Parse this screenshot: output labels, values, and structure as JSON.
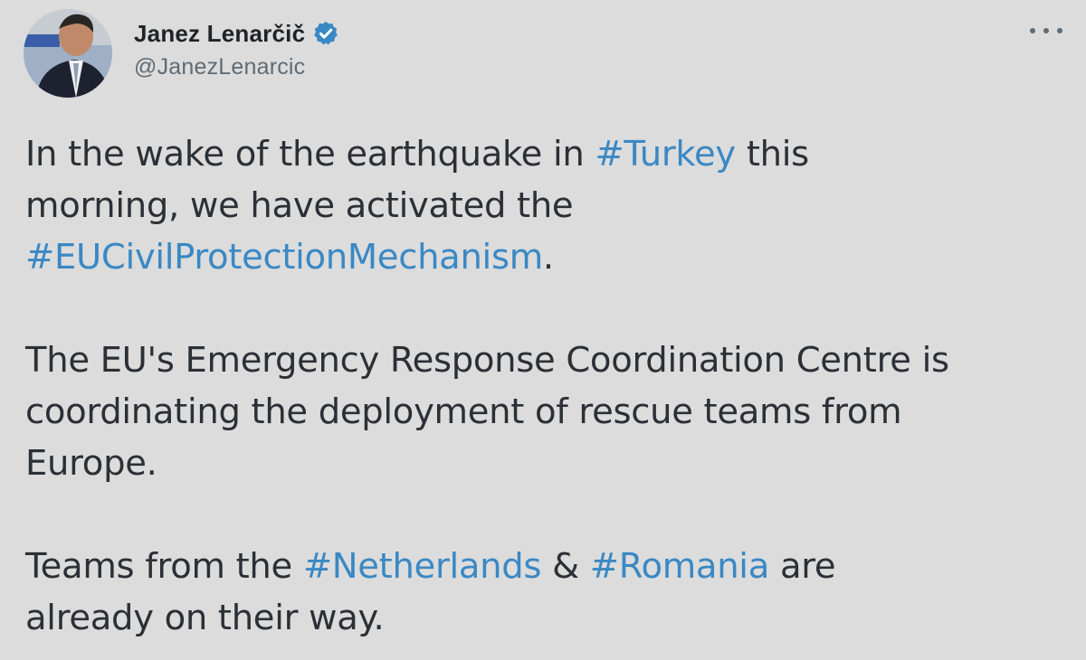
{
  "author": {
    "display_name": "Janez Lenarčič",
    "handle": "@JanezLenarcic",
    "verified_icon": "verified-badge-icon",
    "avatar": "profile-photo",
    "more_icon": "more-options-icon"
  },
  "tweet": {
    "p1": {
      "t1": "In the wake of the earthquake in ",
      "tag1": "#Turkey",
      "t2": " this",
      "line2": "morning, we have activated the",
      "tag2": "#EUCivilProtectionMechanism",
      "t3": "."
    },
    "p2": {
      "line1": "The EU's Emergency Response Coordination Centre is",
      "line2": "coordinating the deployment of rescue teams from",
      "line3": "Europe."
    },
    "p3": {
      "t1": "Teams from the ",
      "tag1": "#Netherlands",
      "t2": " & ",
      "tag2": "#Romania",
      "t3": " are",
      "line2": "already on their way."
    }
  },
  "colors": {
    "background": "#dcdcdc",
    "text": "#2b3036",
    "hashtag": "#3a88c4",
    "verified": "#3a88c4",
    "handle": "#5f6b75"
  }
}
